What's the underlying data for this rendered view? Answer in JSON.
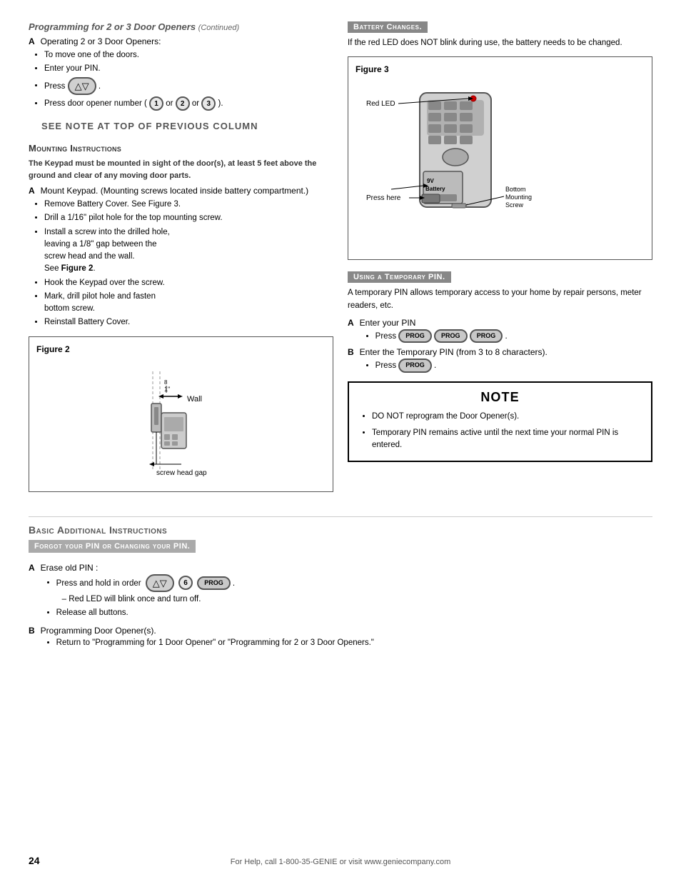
{
  "page": {
    "number": "24",
    "footer": "For Help, call 1-800-35-GENIE or visit www.geniecompany.com"
  },
  "left_col": {
    "prog_section": {
      "title": "Programming for 2 or 3 Door Openers",
      "continued": "(Continued)",
      "item_a_label": "A",
      "item_a_text": "Operating 2 or 3 Door Openers:",
      "bullets": [
        "To move one of the doors.",
        "Enter your PIN.",
        "Press",
        "Press door opener number ("
      ],
      "btn_arrow": "▲▼",
      "btn_1": "1",
      "btn_2": "2",
      "btn_3": "3",
      "or": "or",
      "close_paren": ")."
    },
    "see_note": "SEE NOTE AT TOP OF PREVIOUS COLUMN",
    "mounting": {
      "title": "Mounting Instructions",
      "subtitle": "The Keypad must be mounted in sight of the door(s), at least 5 feet above the ground and clear of any moving door parts.",
      "item_a_label": "A",
      "item_a_text": "Mount Keypad. (Mounting screws located inside battery compartment.)",
      "bullets": [
        "Remove Battery Cover. See Figure 3.",
        "Drill a 1/16\" pilot hole for the top mounting screw.",
        "Install a screw into the drilled hole, leaving a 1/8\" gap between the screw head and the wall. See Figure 2.",
        "Hook the Keypad over the screw.",
        "Mark, drill pilot hole and fasten bottom screw.",
        "Reinstall Battery Cover."
      ],
      "fig2_label": "Figure 2",
      "fig2_caption": "screw head gap",
      "fig2_wall": "Wall",
      "fig2_measure": "1\"",
      "fig2_measure2": "8"
    }
  },
  "right_col": {
    "battery": {
      "title": "Battery Changes.",
      "body": "If the red LED does NOT blink during use, the battery needs to be changed.",
      "fig3_label": "Figure 3",
      "fig3_red_led": "Red LED",
      "fig3_battery": "9V Battery",
      "fig3_screw": "Bottom Mounting Screw",
      "fig3_press": "Press here"
    },
    "temp_pin": {
      "title": "Using a Temporary PIN.",
      "body": "A temporary PIN allows temporary access to your home by repair persons, meter readers, etc.",
      "item_a_label": "A",
      "item_a_text": "Enter your PIN",
      "press_label": "Press",
      "prog_btn": "PROG",
      "item_b_label": "B",
      "item_b_text": "Enter the Temporary PIN (from 3 to 8 characters).",
      "press2_label": "Press"
    },
    "note": {
      "title": "NOTE",
      "items": [
        "DO NOT reprogram the Door Opener(s).",
        "Temporary PIN remains active until  the next time your normal PIN is entered."
      ]
    }
  },
  "bottom": {
    "title": "Basic Additional Instructions",
    "forgot_title": "Forgot your PIN or Changing your PIN.",
    "item_a_label": "A",
    "item_a_text": "Erase old PIN :",
    "erase_bullets": [
      "Press and hold in order",
      "– Red LED will blink once and turn off.",
      "Release all buttons."
    ],
    "item_b_label": "B",
    "item_b_text": "Programming Door Opener(s).",
    "prog_bullets": [
      "Return to \"Programming for 1 Door Opener\" or \"Programming for 2 or 3 Door Openers.\""
    ]
  }
}
